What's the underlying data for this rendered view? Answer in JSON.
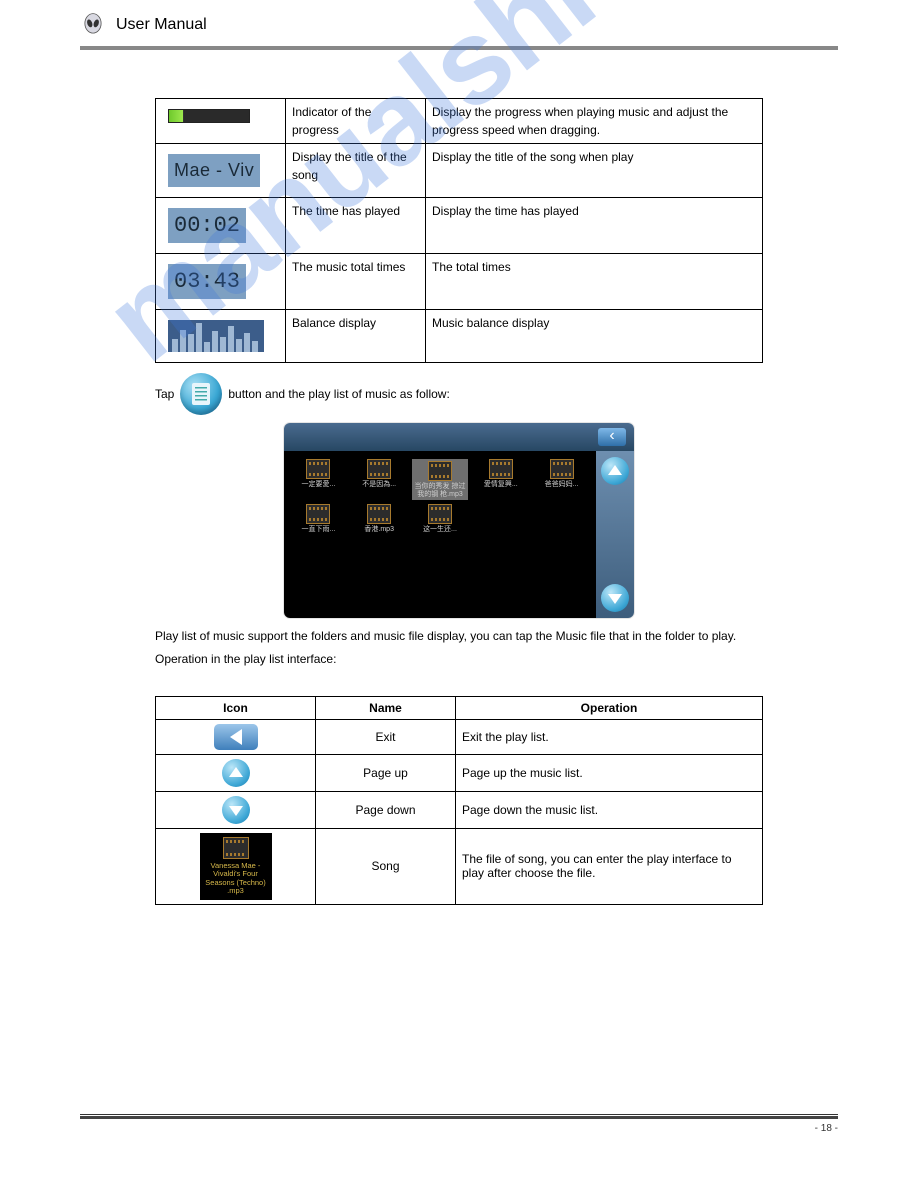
{
  "header": {
    "title": "User Manual"
  },
  "watermark": "manualshive.com",
  "table1": {
    "rows": [
      {
        "icon": "progress",
        "name": "Indicator of the progress",
        "desc": "Display the progress when playing music and adjust the progress speed when dragging."
      },
      {
        "icon": "title",
        "icon_text": "Mae - Viv",
        "name": "Display the title of the song",
        "desc": "Display the title of the song when play"
      },
      {
        "icon": "time",
        "icon_text": "00:02",
        "name": "The time has played",
        "desc": "Display the time has played"
      },
      {
        "icon": "time",
        "icon_text": "03:43",
        "name": "The music total times",
        "desc": "The total times"
      },
      {
        "icon": "eq",
        "name": "Balance display",
        "desc": "Music balance display"
      }
    ]
  },
  "playlist_line": {
    "prefix": "Tap",
    "suffix": "button and the play list of music as follow:"
  },
  "device_items": [
    "一定要愛...",
    "不是因為...",
    "当你的秀发 掠过我的钢 枪.mp3",
    "愛情复興...",
    "爸爸妈妈...",
    "一直下雨...",
    "香港.mp3",
    "这一生还..."
  ],
  "playlist_desc": {
    "line1": "Play list of music support the folders and music file display, you can tap the Music file that in the folder to play.",
    "line2": "Operation in the play list interface:"
  },
  "table2": {
    "headers": [
      "Icon",
      "Name",
      "Operation"
    ],
    "rows": [
      {
        "icon": "back",
        "name": "Exit",
        "op": "Exit the play list."
      },
      {
        "icon": "up",
        "name": "Page up",
        "op": "Page up the music list."
      },
      {
        "icon": "down",
        "name": "Page down",
        "op": "Page down the music list."
      },
      {
        "icon": "song",
        "song_label": "Vanessa Mae - Vivaldi's Four Seasons (Techno) .mp3",
        "name": "Song",
        "op": "The file of song, you can enter the play interface to play after choose the file."
      }
    ]
  },
  "footer": {
    "page": "- 18 -"
  }
}
